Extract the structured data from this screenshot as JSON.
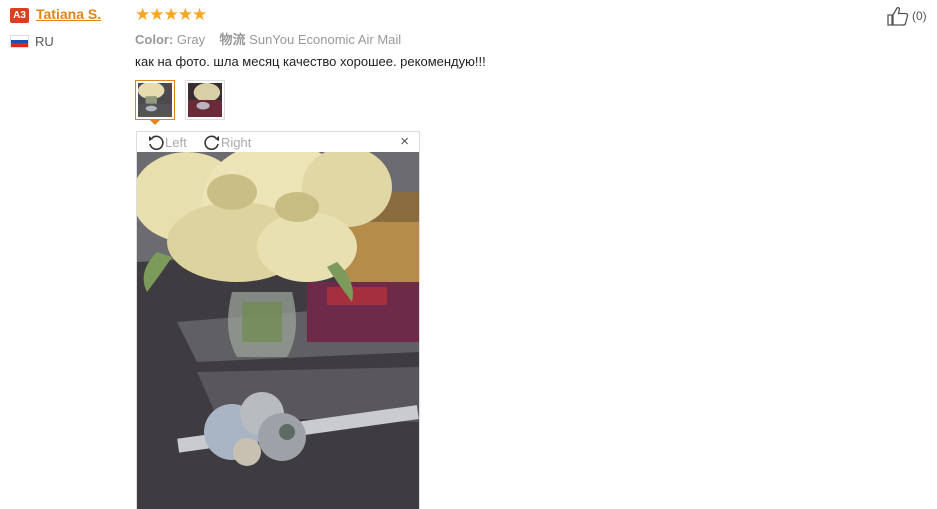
{
  "user": {
    "badge": "A3",
    "name": "Tatiana S.",
    "country": "RU"
  },
  "review": {
    "stars": "★★★★★",
    "rating": 5,
    "color_label": "Color:",
    "color_value": "Gray",
    "logistics_label": "物流",
    "logistics_value": "SunYou Economic Air Mail",
    "text": "как на фото. шла месяц качество хорошее. рекомендую!!!"
  },
  "viewer": {
    "rotate_left": "Left",
    "rotate_right": "Right",
    "close": "×"
  },
  "like": {
    "count": "(0)"
  },
  "colors": {
    "accent": "#e0841a",
    "star": "#f5a623",
    "badge": "#d9411e"
  }
}
